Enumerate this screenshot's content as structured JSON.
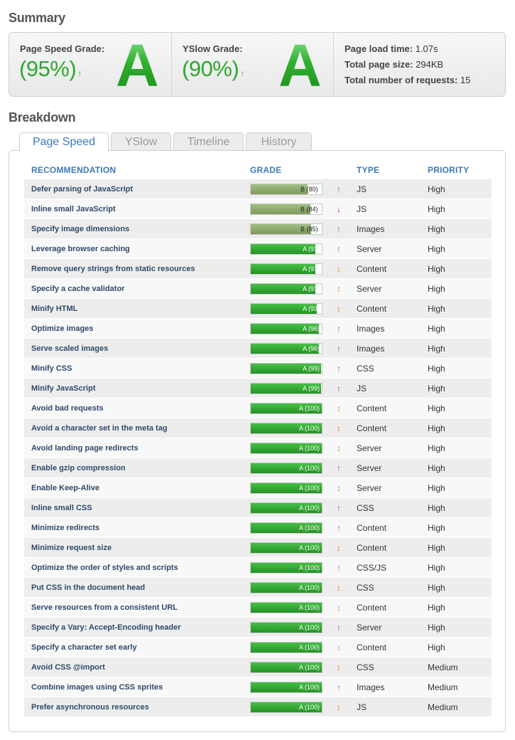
{
  "summary": {
    "title": "Summary",
    "pagespeed": {
      "label": "Page Speed Grade:",
      "percent": "(95%)",
      "letter": "A",
      "trend_icon": "arrow-up-icon"
    },
    "yslow": {
      "label": "YSlow Grade:",
      "percent": "(90%)",
      "letter": "A",
      "trend_icon": "arrow-up-icon"
    },
    "stats": {
      "load_time_label": "Page load time:",
      "load_time": "1.07s",
      "page_size_label": "Total page size:",
      "page_size": "294KB",
      "requests_label": "Total number of requests:",
      "requests": "15"
    }
  },
  "breakdown": {
    "title": "Breakdown",
    "tabs": [
      {
        "label": "Page Speed",
        "active": true
      },
      {
        "label": "YSlow",
        "active": false
      },
      {
        "label": "Timeline",
        "active": false
      },
      {
        "label": "History",
        "active": false
      }
    ],
    "headers": {
      "recommendation": "RECOMMENDATION",
      "grade": "GRADE",
      "type": "TYPE",
      "priority": "PRIORITY"
    },
    "colors": {
      "grade_a": "#2fa52f",
      "grade_b": "#8aa86c",
      "trend_up": "#3aa03a",
      "trend_down": "#d02020",
      "trend_flat": "#e08a1e"
    },
    "rows": [
      {
        "rec": "Defer parsing of JavaScript",
        "grade": "B",
        "score": 80,
        "grade_label": "B (80)",
        "trend": "up",
        "type": "JS",
        "priority": "High"
      },
      {
        "rec": "Inline small JavaScript",
        "grade": "B",
        "score": 84,
        "grade_label": "B (84)",
        "trend": "down",
        "type": "JS",
        "priority": "High"
      },
      {
        "rec": "Specify image dimensions",
        "grade": "B",
        "score": 85,
        "grade_label": "B (85)",
        "trend": "up",
        "type": "Images",
        "priority": "High"
      },
      {
        "rec": "Leverage browser caching",
        "grade": "A",
        "score": 91,
        "grade_label": "A (91)",
        "trend": "up",
        "type": "Server",
        "priority": "High"
      },
      {
        "rec": "Remove query strings from static resources",
        "grade": "A",
        "score": 91,
        "grade_label": "A (91)",
        "trend": "flat",
        "type": "Content",
        "priority": "High"
      },
      {
        "rec": "Specify a cache validator",
        "grade": "A",
        "score": 91,
        "grade_label": "A (91)",
        "trend": "flat",
        "type": "Server",
        "priority": "High"
      },
      {
        "rec": "Minify HTML",
        "grade": "A",
        "score": 93,
        "grade_label": "A (93)",
        "trend": "flat",
        "type": "Content",
        "priority": "High"
      },
      {
        "rec": "Optimize images",
        "grade": "A",
        "score": 96,
        "grade_label": "A (96)",
        "trend": "up",
        "type": "Images",
        "priority": "High"
      },
      {
        "rec": "Serve scaled images",
        "grade": "A",
        "score": 96,
        "grade_label": "A (96)",
        "trend": "up",
        "type": "Images",
        "priority": "High"
      },
      {
        "rec": "Minify CSS",
        "grade": "A",
        "score": 99,
        "grade_label": "A (99)",
        "trend": "up",
        "type": "CSS",
        "priority": "High"
      },
      {
        "rec": "Minify JavaScript",
        "grade": "A",
        "score": 99,
        "grade_label": "A (99)",
        "trend": "up",
        "type": "JS",
        "priority": "High"
      },
      {
        "rec": "Avoid bad requests",
        "grade": "A",
        "score": 100,
        "grade_label": "A (100)",
        "trend": "flat",
        "type": "Content",
        "priority": "High"
      },
      {
        "rec": "Avoid a character set in the meta tag",
        "grade": "A",
        "score": 100,
        "grade_label": "A (100)",
        "trend": "flat",
        "type": "Content",
        "priority": "High"
      },
      {
        "rec": "Avoid landing page redirects",
        "grade": "A",
        "score": 100,
        "grade_label": "A (100)",
        "trend": "flat",
        "type": "Server",
        "priority": "High"
      },
      {
        "rec": "Enable gzip compression",
        "grade": "A",
        "score": 100,
        "grade_label": "A (100)",
        "trend": "up",
        "type": "Server",
        "priority": "High"
      },
      {
        "rec": "Enable Keep-Alive",
        "grade": "A",
        "score": 100,
        "grade_label": "A (100)",
        "trend": "flat",
        "type": "Server",
        "priority": "High"
      },
      {
        "rec": "Inline small CSS",
        "grade": "A",
        "score": 100,
        "grade_label": "A (100)",
        "trend": "up",
        "type": "CSS",
        "priority": "High"
      },
      {
        "rec": "Minimize redirects",
        "grade": "A",
        "score": 100,
        "grade_label": "A (100)",
        "trend": "up",
        "type": "Content",
        "priority": "High"
      },
      {
        "rec": "Minimize request size",
        "grade": "A",
        "score": 100,
        "grade_label": "A (100)",
        "trend": "flat",
        "type": "Content",
        "priority": "High"
      },
      {
        "rec": "Optimize the order of styles and scripts",
        "grade": "A",
        "score": 100,
        "grade_label": "A (100)",
        "trend": "up",
        "type": "CSS/JS",
        "priority": "High"
      },
      {
        "rec": "Put CSS in the document head",
        "grade": "A",
        "score": 100,
        "grade_label": "A (100)",
        "trend": "flat",
        "type": "CSS",
        "priority": "High"
      },
      {
        "rec": "Serve resources from a consistent URL",
        "grade": "A",
        "score": 100,
        "grade_label": "A (100)",
        "trend": "flat",
        "type": "Content",
        "priority": "High"
      },
      {
        "rec": "Specify a Vary: Accept-Encoding header",
        "grade": "A",
        "score": 100,
        "grade_label": "A (100)",
        "trend": "up",
        "type": "Server",
        "priority": "High"
      },
      {
        "rec": "Specify a character set early",
        "grade": "A",
        "score": 100,
        "grade_label": "A (100)",
        "trend": "flat",
        "type": "Content",
        "priority": "High"
      },
      {
        "rec": "Avoid CSS @import",
        "grade": "A",
        "score": 100,
        "grade_label": "A (100)",
        "trend": "flat",
        "type": "CSS",
        "priority": "Medium"
      },
      {
        "rec": "Combine images using CSS sprites",
        "grade": "A",
        "score": 100,
        "grade_label": "A (100)",
        "trend": "up",
        "type": "Images",
        "priority": "Medium"
      },
      {
        "rec": "Prefer asynchronous resources",
        "grade": "A",
        "score": 100,
        "grade_label": "A (100)",
        "trend": "flat",
        "type": "JS",
        "priority": "Medium"
      }
    ]
  }
}
